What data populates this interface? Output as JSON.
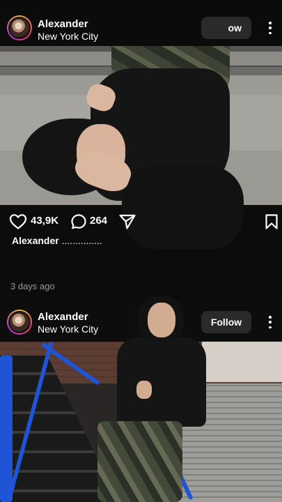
{
  "posts": [
    {
      "user": {
        "name": "Alexander",
        "location": "New York City"
      },
      "follow_label": "ow",
      "actions": {
        "likes": "43,9K",
        "comments": "264"
      },
      "caption": {
        "user": "Alexander",
        "text": " ..............."
      },
      "timestamp": "3 days ago"
    },
    {
      "user": {
        "name": "Alexander",
        "location": "New York City"
      },
      "follow_label": "Follow"
    }
  ]
}
